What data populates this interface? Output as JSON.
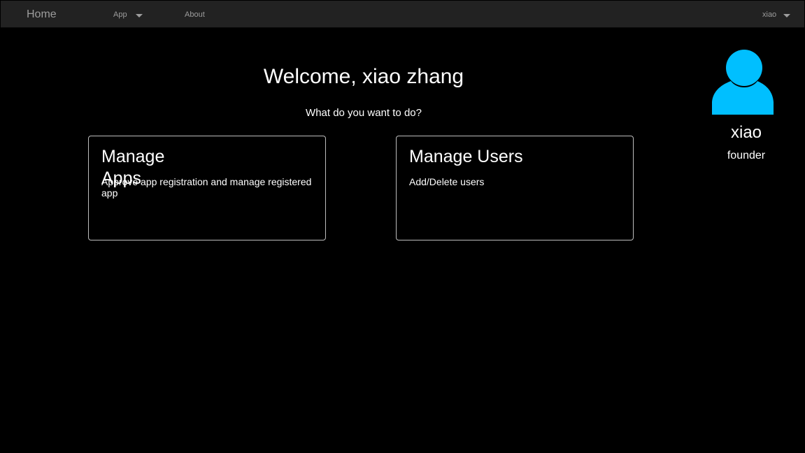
{
  "navbar": {
    "brand": "Home",
    "app_label": "App",
    "about_label": "About",
    "user_label": "xiao",
    "caret_icon": "caret-down-icon"
  },
  "main": {
    "welcome": "Welcome, xiao zhang",
    "prompt": "What do you want to do?"
  },
  "cards": [
    {
      "title": "Manage Apps",
      "description": "Approve app registration and manage registered app"
    },
    {
      "title": "Manage Users",
      "description": "Add/Delete users"
    }
  ],
  "profile": {
    "avatar_icon": "user-icon",
    "name": "xiao",
    "role": "founder"
  },
  "colors": {
    "background": "#000000",
    "navbar": "#222222",
    "nav_text": "#9d9d9d",
    "avatar": "#00bfff",
    "card_border": "#bdbdbd"
  }
}
